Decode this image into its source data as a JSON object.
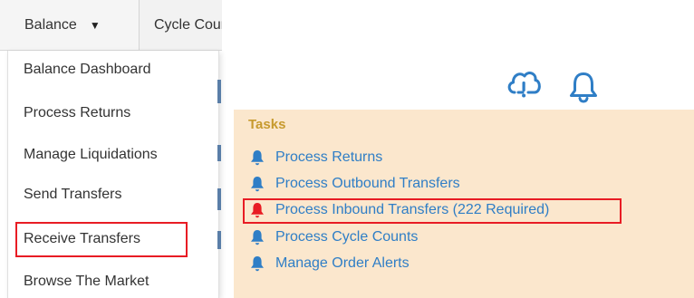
{
  "nav": {
    "tabs": [
      {
        "label": "Balance",
        "has_caret": true,
        "caret_glyph": "▼"
      },
      {
        "label": "Cycle Counts"
      }
    ]
  },
  "dropdown": {
    "items": [
      {
        "label": "Balance Dashboard"
      },
      {
        "label": "Process Returns"
      },
      {
        "label": "Manage Liquidations"
      },
      {
        "label": "Send Transfers"
      },
      {
        "label": "Receive Transfers",
        "highlighted": true
      },
      {
        "label": "Browse The Market"
      }
    ]
  },
  "header_icons": [
    {
      "name": "cloud-alert-icon",
      "color": "#2f7ec6"
    },
    {
      "name": "bell-icon",
      "color": "#2f7ec6"
    }
  ],
  "tasks": {
    "title": "Tasks",
    "items": [
      {
        "label": "Process Returns",
        "icon": "bell-icon",
        "icon_color": "#2f7ec6"
      },
      {
        "label": "Process Outbound Transfers",
        "icon": "bell-icon",
        "icon_color": "#2f7ec6"
      },
      {
        "label": "Process Inbound Transfers (222 Required)",
        "icon": "bell-icon",
        "icon_color": "#e81c24",
        "highlighted": true
      },
      {
        "label": "Process Cycle Counts",
        "icon": "bell-icon",
        "icon_color": "#2f7ec6"
      },
      {
        "label": "Manage Order Alerts",
        "icon": "bell-icon",
        "icon_color": "#2f7ec6"
      }
    ]
  },
  "colors": {
    "accent": "#2f7ec6",
    "alert": "#e81c24",
    "tasks_background": "#fbe7cd",
    "tasks_title": "#c79a2e"
  }
}
